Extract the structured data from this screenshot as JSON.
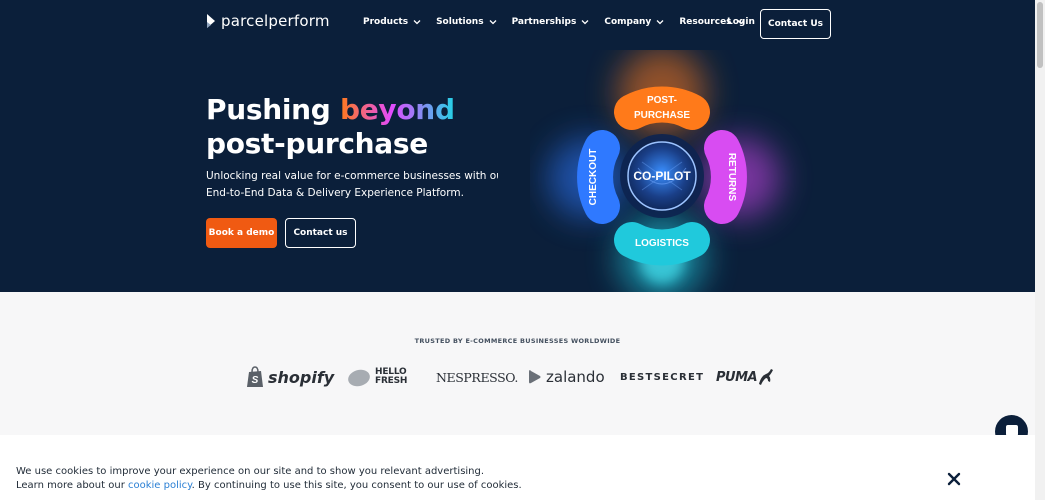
{
  "nav": {
    "brand": "parcelperform",
    "menu": [
      {
        "label": "Products"
      },
      {
        "label": "Solutions"
      },
      {
        "label": "Partnerships"
      },
      {
        "label": "Company"
      },
      {
        "label": "Resources"
      }
    ],
    "login": "Login",
    "contact": "Contact Us"
  },
  "hero": {
    "headline_word1": "Pushing",
    "headline_word2": "beyond",
    "headline_line2": "post-purchase",
    "subtitle_line1": "Unlocking real value for e-commerce businesses with our",
    "subtitle_line2": "End-to-End Data & Delivery Experience Platform.",
    "cta_primary": "Book a demo",
    "cta_secondary": "Contact us",
    "wheel": {
      "center": "CO-PILOT",
      "segments": {
        "top_line1": "POST-",
        "top_line2": "PURCHASE",
        "right": "RETURNS",
        "bottom": "LOGISTICS",
        "left": "CHECKOUT"
      }
    }
  },
  "trusted": {
    "label": "TRUSTED BY E-COMMERCE BUSINESSES WORLDWIDE",
    "brands": {
      "shopify": "shopify",
      "hellofresh_line1": "HELLO",
      "hellofresh_line2": "FRESH",
      "nespresso": "NESPRESSO.",
      "zalando": "zalando",
      "bestsecret": "BESTSECRET",
      "puma": "PUMA"
    }
  },
  "cookie": {
    "line1": "We use cookies to improve your experience on our site and to show you relevant advertising.",
    "pre_link": "Learn more about our ",
    "link": "cookie policy",
    "post_link": ". By continuing to use this site, you consent to our use of cookies."
  },
  "colors": {
    "hero_bg": "#0b1f3a",
    "cta_orange": "#f05a12",
    "link_blue": "#2a7fd4",
    "segment_orange": "#ff7a1a",
    "segment_magenta": "#e24bff",
    "segment_cyan": "#22d4e6",
    "segment_blue": "#2f79ff"
  }
}
